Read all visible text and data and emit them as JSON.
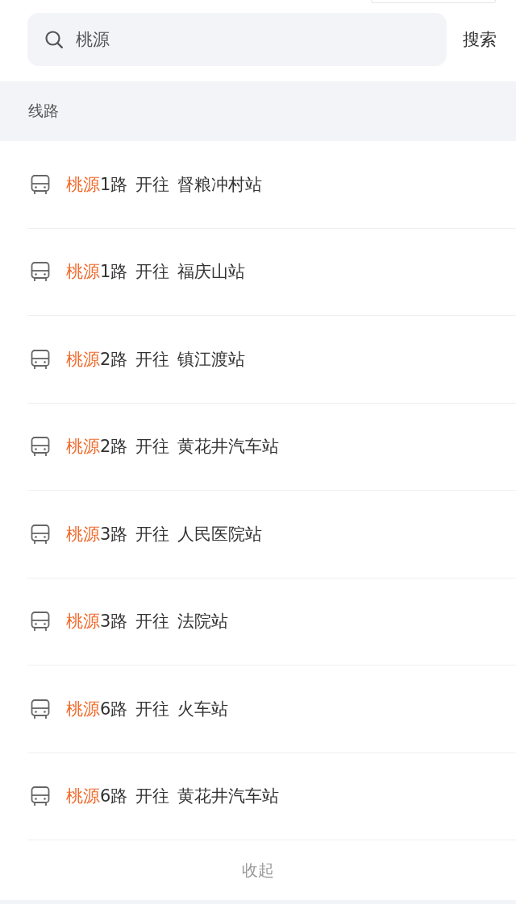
{
  "search": {
    "value": "桃源",
    "button": "搜索"
  },
  "section": {
    "title": "线路"
  },
  "routes": [
    {
      "match": "桃源",
      "suffix": "1路",
      "direction": "开往",
      "destination": "督粮冲村站"
    },
    {
      "match": "桃源",
      "suffix": "1路",
      "direction": "开往",
      "destination": "福庆山站"
    },
    {
      "match": "桃源",
      "suffix": "2路",
      "direction": "开往",
      "destination": "镇江渡站"
    },
    {
      "match": "桃源",
      "suffix": "2路",
      "direction": "开往",
      "destination": "黄花井汽车站"
    },
    {
      "match": "桃源",
      "suffix": "3路",
      "direction": "开往",
      "destination": "人民医院站"
    },
    {
      "match": "桃源",
      "suffix": "3路",
      "direction": "开往",
      "destination": "法院站"
    },
    {
      "match": "桃源",
      "suffix": "6路",
      "direction": "开往",
      "destination": "火车站"
    },
    {
      "match": "桃源",
      "suffix": "6路",
      "direction": "开往",
      "destination": "黄花井汽车站"
    }
  ],
  "collapse": {
    "label": "收起"
  }
}
